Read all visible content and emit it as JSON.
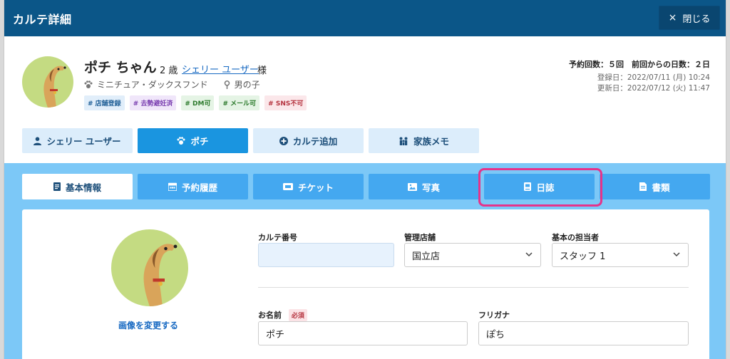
{
  "header": {
    "title": "カルテ詳細",
    "close_label": "閉じる",
    "close_icon": "×"
  },
  "profile": {
    "name": "ポチ ちゃん",
    "age": "2 歳",
    "owner_link": "シェリー ユーザー",
    "honorific": "様",
    "breed": "ミニチュア・ダックスフンド",
    "sex": "男の子",
    "tags": [
      "# 店舗登録",
      "# 去勢避妊済",
      "# DM可",
      "# メール可",
      "# SNS不可"
    ]
  },
  "stats": {
    "summary": "予約回数：５回　前回からの日数：２日",
    "registered": "登録日：2022/07/11 (月) 10:24",
    "updated": "更新日：2022/07/12 (火) 11:47"
  },
  "actions": [
    {
      "label": "シェリー ユーザー",
      "icon": "user-icon"
    },
    {
      "label": "ポチ",
      "icon": "paw-icon"
    },
    {
      "label": "カルテ追加",
      "icon": "plus-circle-icon"
    },
    {
      "label": "家族メモ",
      "icon": "family-icon"
    }
  ],
  "tabs": [
    {
      "label": "基本情報",
      "icon": "document-icon"
    },
    {
      "label": "予約履歴",
      "icon": "calendar-icon"
    },
    {
      "label": "チケット",
      "icon": "ticket-icon"
    },
    {
      "label": "写真",
      "icon": "image-icon"
    },
    {
      "label": "日誌",
      "icon": "journal-icon"
    },
    {
      "label": "書類",
      "icon": "file-icon"
    }
  ],
  "form": {
    "change_image": "画像を変更する",
    "karte_no_label": "カルテ番号",
    "karte_no_value": "",
    "store_label": "管理店舗",
    "store_value": "国立店",
    "staff_label": "基本の担当者",
    "staff_value": "スタッフ 1",
    "name_label": "お名前",
    "required": "必須",
    "name_value": "ポチ",
    "furigana_label": "フリガナ",
    "furigana_value": "ぽち"
  },
  "colors": {
    "header": "#0b5688",
    "accent": "#1a95e0",
    "tab": "#44a8f0",
    "zone": "#7cc8f7",
    "highlight": "#e6338a"
  }
}
